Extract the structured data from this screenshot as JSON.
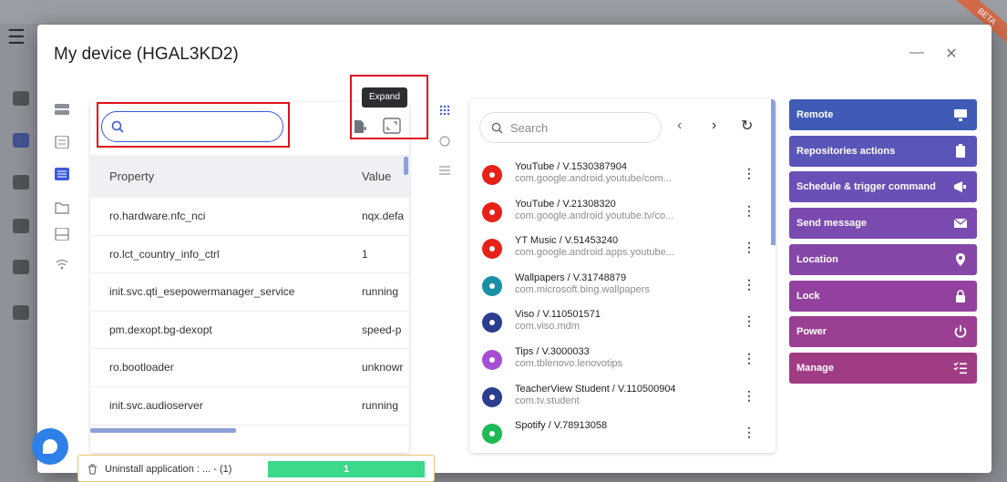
{
  "modal": {
    "title": "My device (HGAL3KD2)",
    "minimize_label": "—",
    "close_label": "✕"
  },
  "badge": {
    "label": "BETA"
  },
  "properties": {
    "search_value": "",
    "tooltip": "Expand",
    "columns": {
      "property": "Property",
      "value": "Value"
    },
    "rows": [
      {
        "property": "ro.hardware.nfc_nci",
        "value": "nqx.defa"
      },
      {
        "property": "ro.lct_country_info_ctrl",
        "value": "1"
      },
      {
        "property": "init.svc.qti_esepowermanager_service",
        "value": "running"
      },
      {
        "property": "pm.dexopt.bg-dexopt",
        "value": "speed-p"
      },
      {
        "property": "ro.bootloader",
        "value": "unknowr"
      },
      {
        "property": "init.svc.audioserver",
        "value": "running"
      }
    ]
  },
  "apps": {
    "search_placeholder": "Search",
    "prev_label": "‹",
    "next_label": "›",
    "refresh_label": "↻",
    "items": [
      {
        "name": "YouTube / V.1530387904",
        "package": "com.google.android.youtube/com...",
        "icon": "youtube-icon",
        "color": "#e62117"
      },
      {
        "name": "YouTube / V.21308320",
        "package": "com.google.android.youtube.tv/co...",
        "icon": "youtube-tv-icon",
        "color": "#e62117"
      },
      {
        "name": "YT Music / V.51453240",
        "package": "com.google.android.apps.youtube...",
        "icon": "yt-music-icon",
        "color": "#e62117"
      },
      {
        "name": "Wallpapers / V.31748879",
        "package": "com.microsoft.bing.wallpapers",
        "icon": "wallpapers-icon",
        "color": "#1b8fa6"
      },
      {
        "name": "Viso / V.110501571",
        "package": "com.viso.mdm",
        "icon": "viso-icon",
        "color": "#2a3d8f"
      },
      {
        "name": "Tips / V.3000033",
        "package": "com.tblenovo.lenovotips",
        "icon": "tips-icon",
        "color": "#a64fd6"
      },
      {
        "name": "TeacherView Student / V.110500904",
        "package": "com.tv.student",
        "icon": "teacherview-icon",
        "color": "#2a3d8f"
      },
      {
        "name": "Spotify / V.78913058",
        "package": "",
        "icon": "spotify-icon",
        "color": "#1db954"
      }
    ]
  },
  "actions": [
    {
      "label": "Remote",
      "icon": "monitor-icon",
      "color": "#3f5bb5"
    },
    {
      "label": "Repositories actions",
      "icon": "clipboard-icon",
      "color": "#5a55b8"
    },
    {
      "label": "Schedule & trigger command",
      "icon": "megaphone-icon",
      "color": "#6a4fb6"
    },
    {
      "label": "Send message",
      "icon": "envelope-icon",
      "color": "#7a4ab0"
    },
    {
      "label": "Location",
      "icon": "location-pin-icon",
      "color": "#8646a8"
    },
    {
      "label": "Lock",
      "icon": "lock-icon",
      "color": "#92429e"
    },
    {
      "label": "Power",
      "icon": "power-icon",
      "color": "#9a3f92"
    },
    {
      "label": "Manage",
      "icon": "checklist-icon",
      "color": "#a03c84"
    }
  ],
  "uninstall": {
    "label": "Uninstall application : ...   - (1)",
    "progress_label": "1",
    "progress": 1.0,
    "progress_color": "#3cd88c"
  },
  "colors": {
    "accent": "#3b5bdb",
    "highlight_box": "#e0101a"
  }
}
